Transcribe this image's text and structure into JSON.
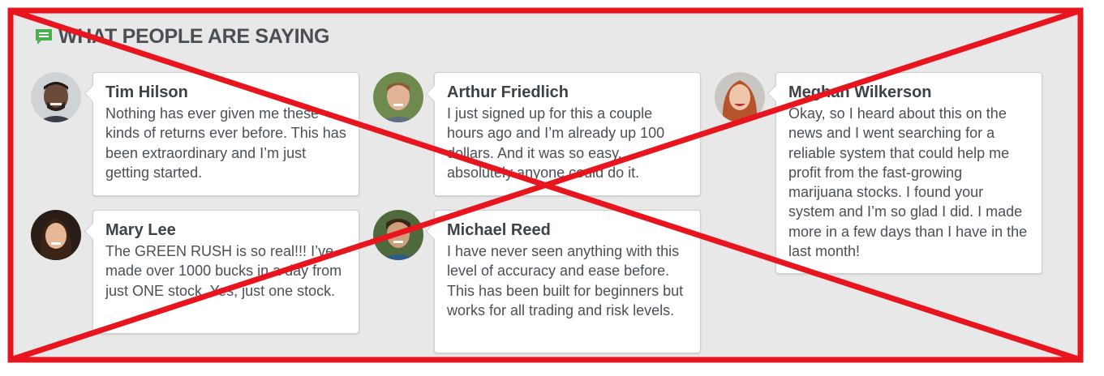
{
  "section": {
    "title": "WHAT PEOPLE ARE SAYING",
    "icon": "chat-bubble-icon",
    "accent_color": "#4caf50"
  },
  "testimonials": [
    {
      "name": "Tim Hilson",
      "quote": "Nothing has ever given me these kinds of returns ever before. This has been extraordinary and I’m just getting started."
    },
    {
      "name": "Arthur Friedlich",
      "quote": "I just signed up for this a couple hours ago and I’m already up 100 dollars. And it was so easy, absolutely anyone could do it."
    },
    {
      "name": "Meghan Wilkerson",
      "quote": "Okay, so I heard about this on the news and I went searching for a reliable system that could help me profit from the fast-growing marijuana stocks. I found your system and I’m so glad I did. I made more in a few days than I have in the last month!"
    },
    {
      "name": "Mary Lee",
      "quote": "The GREEN RUSH is so real!!! I’ve made over 1000 bucks in a day from just ONE stock. Yes, just one stock."
    },
    {
      "name": "Michael Reed",
      "quote": "I have never seen anything with this level of accuracy and ease before. This has been built for beginners but works for all trading and risk levels."
    }
  ],
  "overlay": {
    "type": "red-x-cross-out",
    "color": "#e8141e"
  }
}
